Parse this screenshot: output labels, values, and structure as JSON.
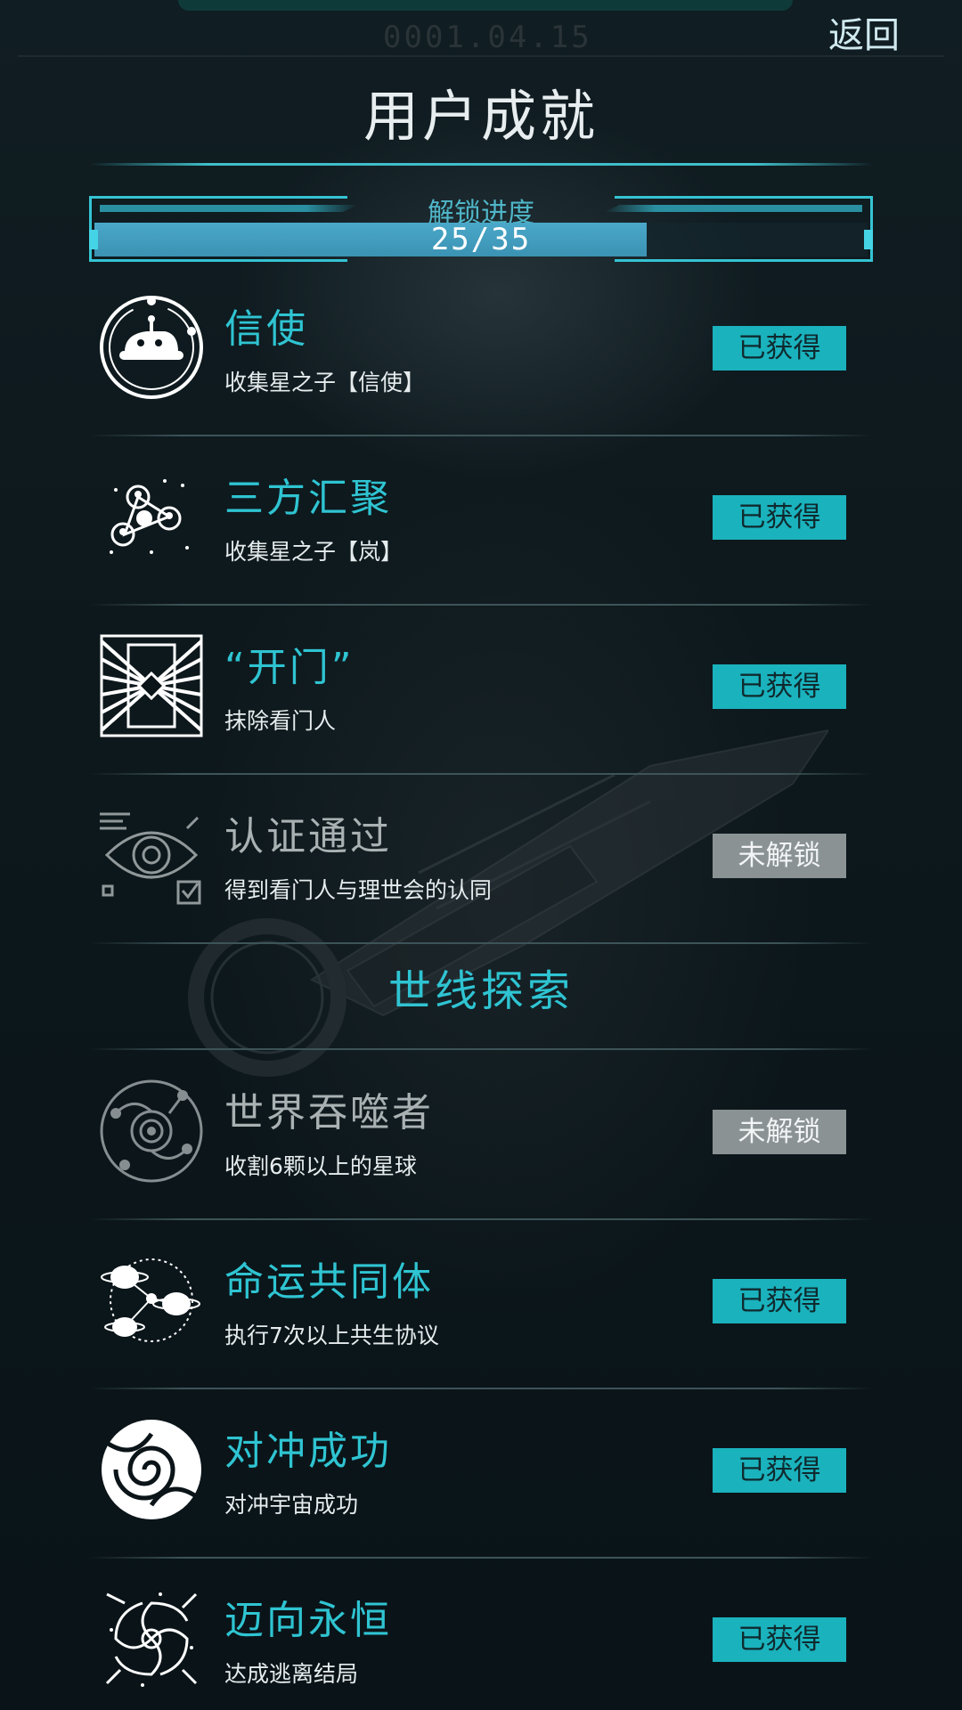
{
  "header": {
    "date": "0001.04.15",
    "back_label": "返回",
    "title": "用户成就"
  },
  "progress": {
    "label": "解锁进度",
    "text": "25/35",
    "unlocked": 25,
    "total": 35,
    "fraction": 0.714
  },
  "colors": {
    "accent": "#2fc4d2",
    "earned_badge": "#1ab2bd",
    "locked_badge": "#8a9294",
    "locked_title": "#a9b1b3"
  },
  "achievements": [
    {
      "title": "信使",
      "desc": "收集星之子【信使】",
      "status": "已获得",
      "earned": true,
      "icon": "messenger-icon"
    },
    {
      "title": "三方汇聚",
      "desc": "收集星之子【岚】",
      "status": "已获得",
      "earned": true,
      "icon": "triad-network-icon"
    },
    {
      "title": "“开门”",
      "desc": "抹除看门人",
      "status": "已获得",
      "earned": true,
      "icon": "open-door-icon"
    },
    {
      "title": "认证通过",
      "desc": "得到看门人与理世会的认同",
      "status": "未解锁",
      "earned": false,
      "icon": "eye-verify-icon"
    }
  ],
  "section": {
    "title": "世线探索"
  },
  "explore_achievements": [
    {
      "title": "世界吞噬者",
      "desc": "收割6颗以上的星球",
      "status": "未解锁",
      "earned": false,
      "icon": "world-eater-icon"
    },
    {
      "title": "命运共同体",
      "desc": "执行7次以上共生协议",
      "status": "已获得",
      "earned": true,
      "icon": "planets-orbit-icon"
    },
    {
      "title": "对冲成功",
      "desc": "对冲宇宙成功",
      "status": "已获得",
      "earned": true,
      "icon": "spiral-vortex-icon"
    },
    {
      "title": "迈向永恒",
      "desc": "达成逃离结局",
      "status": "已获得",
      "earned": true,
      "icon": "galaxy-swirl-icon"
    }
  ]
}
